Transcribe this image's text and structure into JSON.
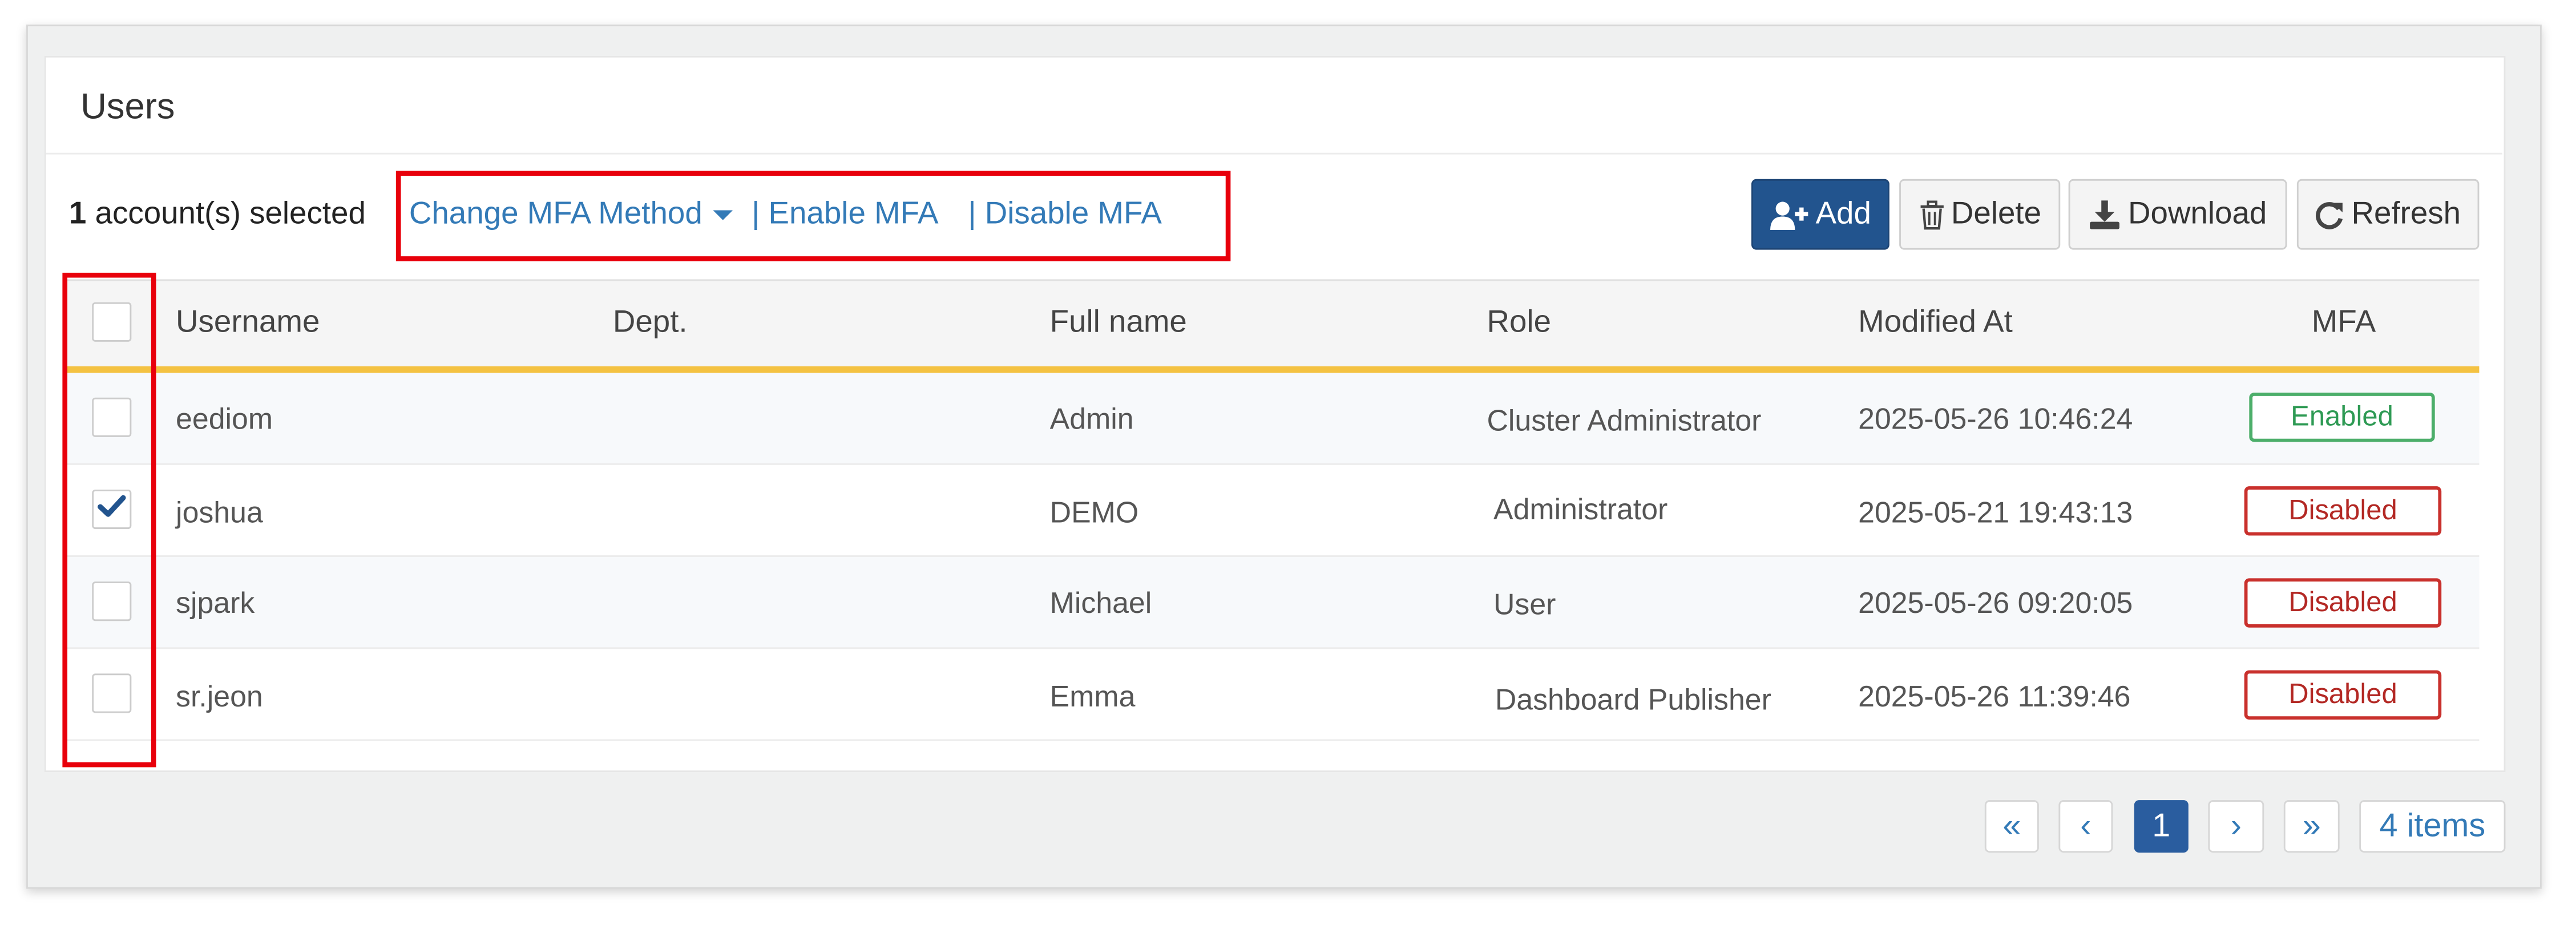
{
  "card": {
    "title": "Users"
  },
  "selection": {
    "count": "1",
    "suffix": " account(s) selected"
  },
  "mfa_actions": {
    "change_method": "Change MFA Method",
    "enable": "| Enable MFA",
    "disable": "| Disable MFA"
  },
  "toolbar": {
    "add": "Add",
    "delete": "Delete",
    "download": "Download",
    "refresh": "Refresh"
  },
  "table": {
    "headers": {
      "username": "Username",
      "dept": "Dept.",
      "fullname": "Full name",
      "role": "Role",
      "modified": "Modified At",
      "mfa": "MFA"
    },
    "rows": [
      {
        "checked": false,
        "username": "eediom",
        "dept": "",
        "fullname": "Admin",
        "role": "Cluster Administrator",
        "modified": "2025-05-26 10:46:24",
        "mfa": "Enabled"
      },
      {
        "checked": true,
        "username": "joshua",
        "dept": "",
        "fullname": "DEMO",
        "role": "Administrator",
        "modified": "2025-05-21 19:43:13",
        "mfa": "Disabled"
      },
      {
        "checked": false,
        "username": "sjpark",
        "dept": "",
        "fullname": "Michael",
        "role": "User",
        "modified": "2025-05-26 09:20:05",
        "mfa": "Disabled"
      },
      {
        "checked": false,
        "username": "sr.jeon",
        "dept": "",
        "fullname": "Emma",
        "role": "Dashboard Publisher",
        "modified": "2025-05-26 11:39:46",
        "mfa": "Disabled"
      }
    ]
  },
  "pagination": {
    "first": "«",
    "prev": "‹",
    "current": "1",
    "next": "›",
    "last": "»",
    "total": "4 items"
  },
  "colors": {
    "primary_button": "#22548e",
    "link": "#337ab7",
    "header_accent": "#f4c242",
    "highlight_box": "#e8000b",
    "enabled_badge": "#4cae6a",
    "disabled_badge": "#c9302c"
  },
  "icons": {
    "add": "user-plus-icon",
    "delete": "trash-icon",
    "download": "download-icon",
    "refresh": "refresh-icon",
    "checked": "checkmark-icon"
  }
}
